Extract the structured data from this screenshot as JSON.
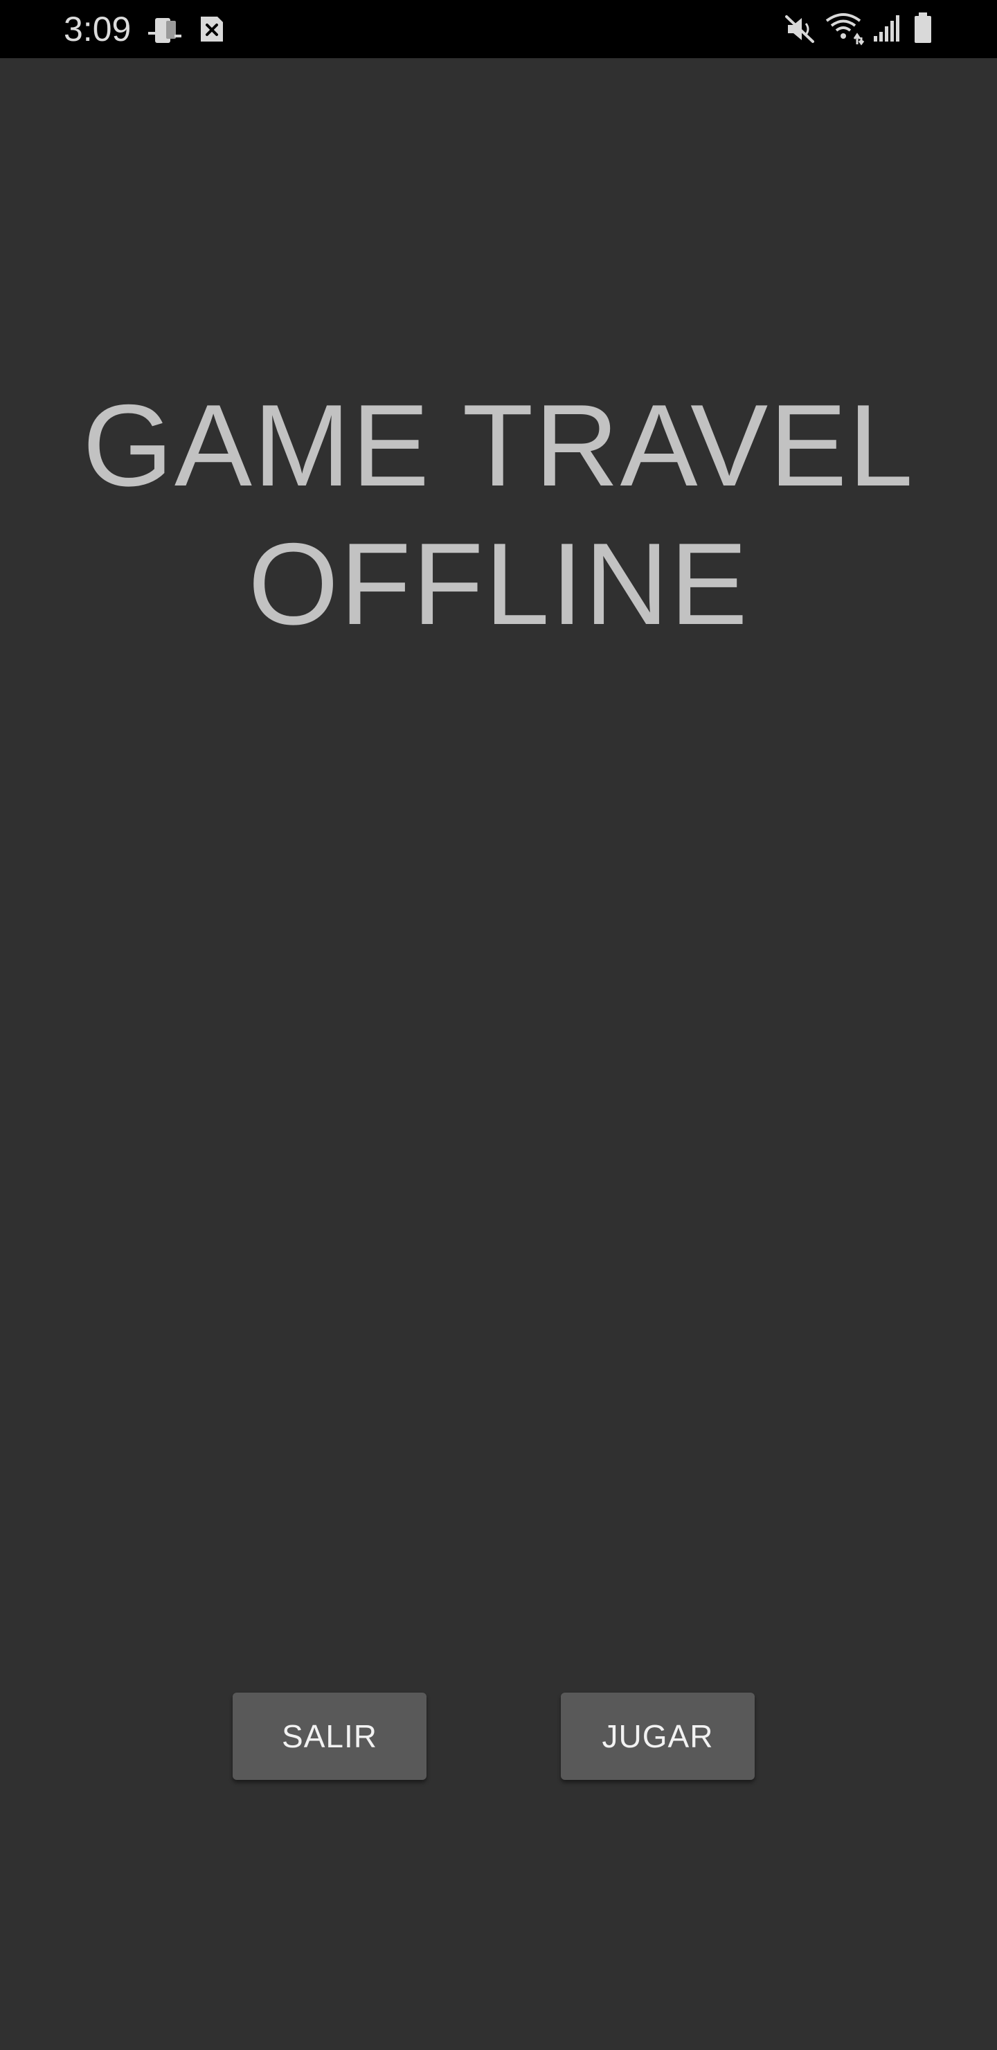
{
  "status_bar": {
    "time": "3:09",
    "icons": [
      "phone-notification-icon",
      "sim-notification-icon",
      "mute-icon",
      "wifi-icon",
      "cell-signal-icon",
      "battery-icon"
    ]
  },
  "title": {
    "line1": "GAME TRAVEL",
    "line2": "OFFLINE"
  },
  "buttons": {
    "exit_label": "SALIR",
    "play_label": "JUGAR"
  },
  "colors": {
    "background": "#303030",
    "status_bar": "#000000",
    "title_text": "#c2c2c2",
    "button_bg": "#595959",
    "button_text": "#f2f2f2"
  }
}
